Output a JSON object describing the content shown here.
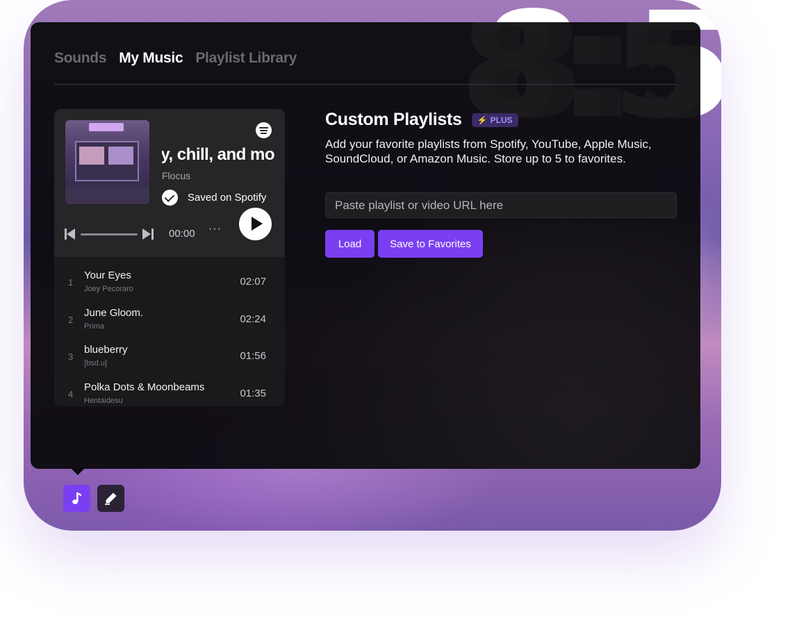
{
  "clock": {
    "digits": "8:5"
  },
  "tabs": [
    {
      "label": "Sounds",
      "active": false
    },
    {
      "label": "My Music",
      "active": true
    },
    {
      "label": "Playlist Library",
      "active": false
    }
  ],
  "player": {
    "playlist_title": "y, chill, and mo",
    "owner": "Flocus",
    "saved_label": "Saved on Spotify",
    "time": "00:00",
    "more": "···",
    "tracks": [
      {
        "num": "1",
        "name": "Your Eyes",
        "artist": "Joey Pecoraro",
        "duration": "02:07"
      },
      {
        "num": "2",
        "name": "June Gloom.",
        "artist": "Prima",
        "duration": "02:24"
      },
      {
        "num": "3",
        "name": "blueberry",
        "artist": "[bsd.u]",
        "duration": "01:56"
      },
      {
        "num": "4",
        "name": "Polka Dots & Moonbeams",
        "artist": "Hentaidesu",
        "duration": "01:35"
      }
    ]
  },
  "custom": {
    "title": "Custom Playlists",
    "badge": "PLUS",
    "badge_icon": "⚡",
    "description": "Add your favorite playlists from Spotify, YouTube, Apple Music, SoundCloud, or Amazon Music. Store up to 5 to favorites.",
    "input_placeholder": "Paste playlist or video URL here",
    "load_label": "Load",
    "save_label": "Save to Favorites"
  },
  "colors": {
    "accent": "#7b3ff2",
    "panel": "#0c0a0e",
    "badge_bg": "#3a2a66"
  }
}
